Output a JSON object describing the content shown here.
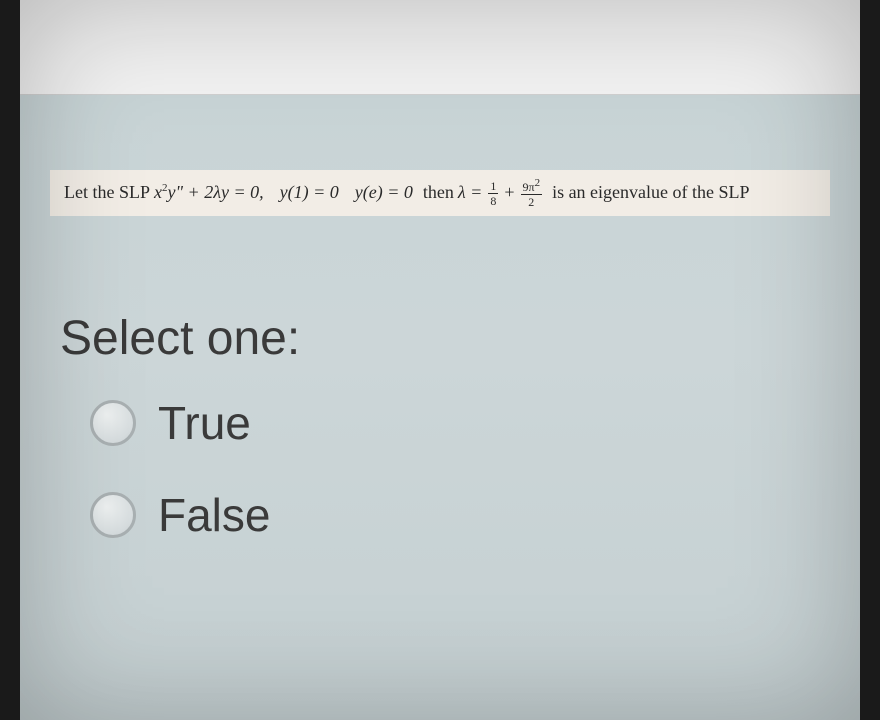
{
  "question": {
    "stem_prefix": "Let the SLP ",
    "equation_part1": "x",
    "equation_sup1": "2",
    "equation_part2": "y\" + 2λy = 0,",
    "cond1": "y(1) = 0",
    "cond2": "y(e) = 0",
    "then_text": "then",
    "lambda_sym": "λ =",
    "frac1_num": "1",
    "frac1_den": "8",
    "plus": "+",
    "frac2_num": "9π",
    "frac2_num_sup": "2",
    "frac2_den": "2",
    "tail": "is an eigenvalue of the SLP"
  },
  "prompt": "Select one:",
  "options": {
    "true_label": "True",
    "false_label": "False"
  }
}
